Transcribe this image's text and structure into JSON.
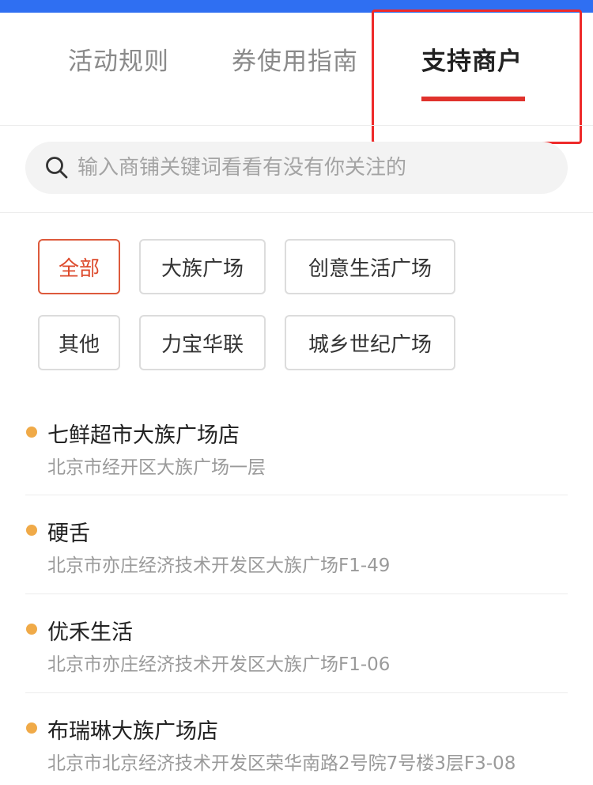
{
  "tabs": [
    "活动规则",
    "券使用指南",
    "支持商户"
  ],
  "search": {
    "placeholder": "输入商铺关键词看看有没有你关注的"
  },
  "filters": [
    "全部",
    "大族广场",
    "创意生活广场",
    "其他",
    "力宝华联",
    "城乡世纪广场"
  ],
  "active_filter": "全部",
  "stores": [
    {
      "name": "七鲜超市大族广场店",
      "address": "北京市经开区大族广场一层"
    },
    {
      "name": "硬舌",
      "address": "北京市亦庄经济技术开发区大族广场F1-49"
    },
    {
      "name": "优禾生活",
      "address": "北京市亦庄经济技术开发区大族广场F1-06"
    },
    {
      "name": "布瑞琳大族广场店",
      "address": "北京市北京经济技术开发区荣华南路2号院7号楼3层F3-08"
    }
  ],
  "colors": {
    "accent": "#e0322c",
    "top_bar": "#2f6ff2",
    "dot": "#f0aa48",
    "highlight": "#ee2a2a"
  },
  "icons": {
    "search": "search-icon"
  }
}
